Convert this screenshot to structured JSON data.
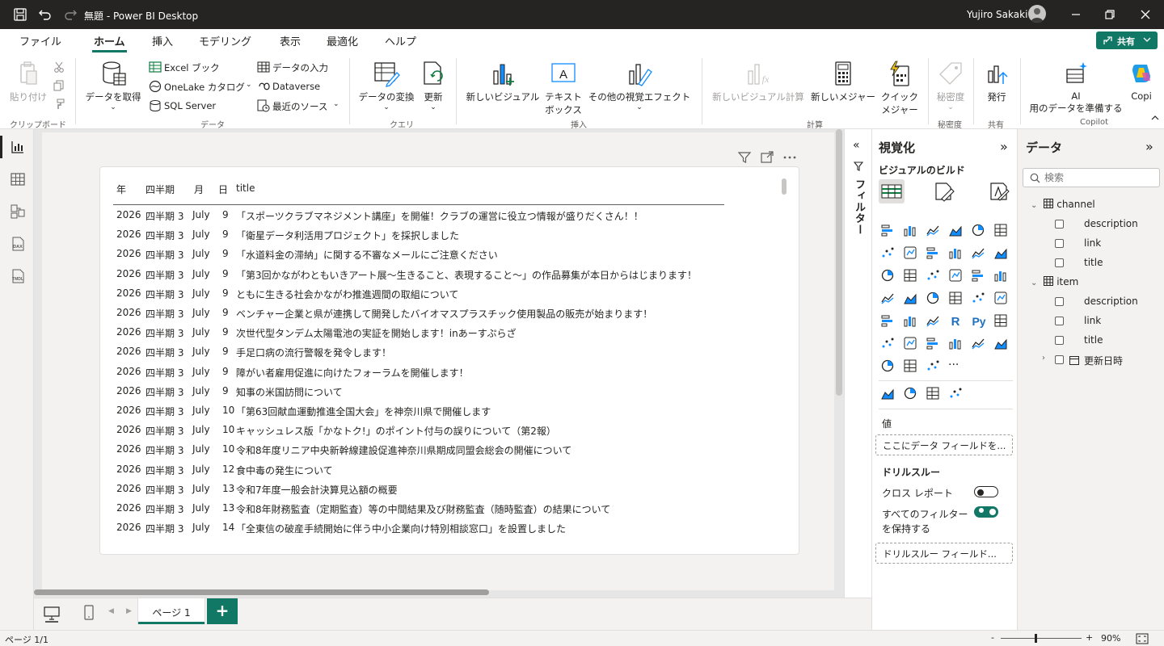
{
  "app": {
    "title": "無題 - Power BI Desktop",
    "user": "Yujiro Sakaki"
  },
  "menu": {
    "tabs": [
      "ファイル",
      "ホーム",
      "挿入",
      "モデリング",
      "表示",
      "最適化",
      "ヘルプ"
    ],
    "active": "ホーム",
    "share_label": "共有"
  },
  "ribbon": {
    "paste": "貼り付け",
    "clipboard_group": "クリップボード",
    "get_data": "データを取得",
    "excel": "Excel ブック",
    "onelake": "OneLake カタログ",
    "sql": "SQL Server",
    "enter_data": "データの入力",
    "dataverse": "Dataverse",
    "recent": "最近のソース",
    "data_group": "データ",
    "transform": "データの変換",
    "refresh": "更新",
    "query_group": "クエリ",
    "new_visual": "新しいビジュアル",
    "textbox_1": "テキスト",
    "textbox_2": "ボックス",
    "more_visuals": "その他の視覚エフェクト",
    "insert_group": "挿入",
    "new_visual_calc": "新しいビジュアル計算",
    "new_measure": "新しいメジャー",
    "quick_1": "クイック",
    "quick_2": "メジャー",
    "calc_group": "計算",
    "sensitivity": "秘密度",
    "sensitivity_group": "秘密度",
    "publish": "発行",
    "share_group": "共有",
    "ai_1": "AI",
    "ai_2": "用のデータを準備する",
    "copilot": "Copi",
    "copilot_group": "Copilot"
  },
  "table": {
    "headers": [
      "年",
      "四半期",
      "月",
      "日",
      "title"
    ],
    "rows": [
      [
        "2026",
        "四半期 3",
        "July",
        "9",
        "「スポーツクラブマネジメント講座」を開催！クラブの運営に役立つ情報が盛りだくさん！！"
      ],
      [
        "2026",
        "四半期 3",
        "July",
        "9",
        "「衛星データ利活用プロジェクト」を採択しました"
      ],
      [
        "2026",
        "四半期 3",
        "July",
        "9",
        "「水道料金の滞納」に関する不審なメールにご注意ください"
      ],
      [
        "2026",
        "四半期 3",
        "July",
        "9",
        "「第3回かながわともいきアート展～生きること、表現すること～」の作品募集が本日からはじまります！"
      ],
      [
        "2026",
        "四半期 3",
        "July",
        "9",
        "ともに生きる社会かながわ推進週間の取組について"
      ],
      [
        "2026",
        "四半期 3",
        "July",
        "9",
        "ベンチャー企業と県が連携して開発したバイオマスプラスチック使用製品の販売が始まります！"
      ],
      [
        "2026",
        "四半期 3",
        "July",
        "9",
        "次世代型タンデム太陽電池の実証を開始します！inあーすぷらざ"
      ],
      [
        "2026",
        "四半期 3",
        "July",
        "9",
        "手足口病の流行警報を発令します！"
      ],
      [
        "2026",
        "四半期 3",
        "July",
        "9",
        "障がい者雇用促進に向けたフォーラムを開催します！"
      ],
      [
        "2026",
        "四半期 3",
        "July",
        "9",
        "知事の米国訪問について"
      ],
      [
        "2026",
        "四半期 3",
        "July",
        "10",
        "「第63回献血運動推進全国大会」を神奈川県で開催します"
      ],
      [
        "2026",
        "四半期 3",
        "July",
        "10",
        "キャッシュレス版「かなトク!」のポイント付与の誤りについて（第2報）"
      ],
      [
        "2026",
        "四半期 3",
        "July",
        "10",
        "令和8年度リニア中央新幹線建設促進神奈川県期成同盟会総会の開催について"
      ],
      [
        "2026",
        "四半期 3",
        "July",
        "12",
        "食中毒の発生について"
      ],
      [
        "2026",
        "四半期 3",
        "July",
        "13",
        "令和7年度一般会計決算見込額の概要"
      ],
      [
        "2026",
        "四半期 3",
        "July",
        "13",
        "令和8年財務監査（定期監査）等の中間結果及び財務監査（随時監査）の結果について"
      ],
      [
        "2026",
        "四半期 3",
        "July",
        "14",
        "「全東信の破産手続開始に伴う中小企業向け特別相談窓口」を設置しました"
      ]
    ]
  },
  "filters": {
    "label": "フィルター"
  },
  "viz": {
    "title": "視覚化",
    "build": "ビジュアルのビルド",
    "values_label": "値",
    "values_placeholder": "ここにデータ フィールドを...",
    "drill_title": "ドリルスルー",
    "cross_report": "クロス レポート",
    "cross_report_on": false,
    "keep_filters_1": "すべてのフィルター",
    "keep_filters_2": "を保持する",
    "keep_filters_on": true,
    "drill_placeholder": "ドリルスルー フィールド...",
    "more": "···"
  },
  "data": {
    "title": "データ",
    "search_placeholder": "検索",
    "tables": [
      {
        "name": "channel",
        "fields": [
          "description",
          "link",
          "title"
        ]
      },
      {
        "name": "item",
        "fields": [
          "description",
          "link",
          "title",
          "更新日時"
        ]
      }
    ]
  },
  "pages": {
    "tab": "ページ 1",
    "add": "+"
  },
  "status": {
    "page": "ページ 1/1",
    "zoom": "90%",
    "zoom_minus": "-",
    "zoom_plus": "+"
  },
  "colors": {
    "accent": "#117865",
    "titlebar": "#252423",
    "chart_blue": "#118dff"
  }
}
